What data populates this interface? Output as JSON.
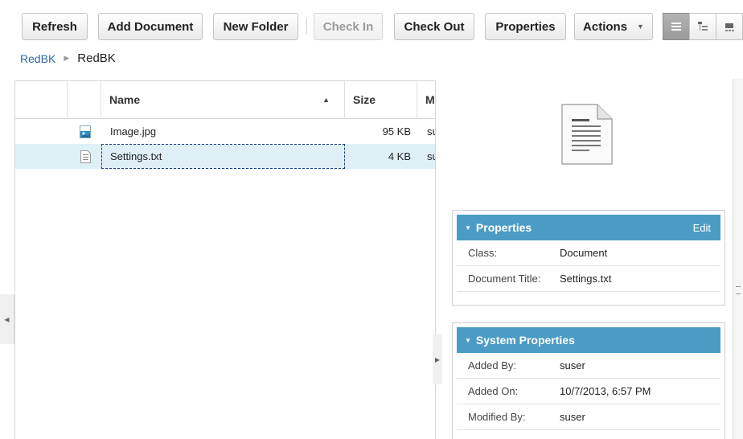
{
  "toolbar": {
    "refresh": "Refresh",
    "add_document": "Add Document",
    "new_folder": "New Folder",
    "check_in": "Check In",
    "check_out": "Check Out",
    "properties": "Properties",
    "actions": "Actions",
    "actions_caret": "▼"
  },
  "breadcrumb": {
    "root": "RedBK",
    "separator": "▶",
    "current": "RedBK"
  },
  "grid": {
    "columns": [
      "Name",
      "Size",
      "M"
    ],
    "sort_indicator": "▲",
    "rows": [
      {
        "icon": "image-file-icon",
        "name": "Image.jpg",
        "size": "95 KB",
        "m": "su",
        "selected": false
      },
      {
        "icon": "text-file-icon",
        "name": "Settings.txt",
        "size": "4 KB",
        "m": "su",
        "selected": true
      }
    ]
  },
  "properties_panel": {
    "title": "Properties",
    "edit": "Edit",
    "rows": [
      {
        "label": "Class:",
        "value": "Document"
      },
      {
        "label": "Document Title:",
        "value": "Settings.txt"
      }
    ]
  },
  "system_properties_panel": {
    "title": "System Properties",
    "rows": [
      {
        "label": "Added By:",
        "value": "suser"
      },
      {
        "label": "Added On:",
        "value": "10/7/2013, 6:57 PM"
      },
      {
        "label": "Modified By:",
        "value": "suser"
      }
    ]
  },
  "colors": {
    "panel_header": "#4b9cc4",
    "selected_row": "#dfeff6",
    "link": "#2a6aa3"
  }
}
